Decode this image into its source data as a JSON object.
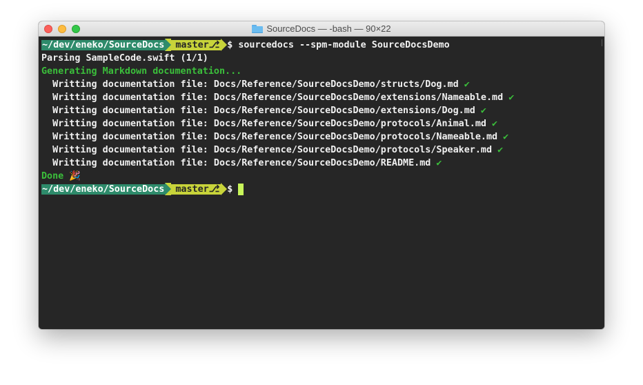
{
  "window": {
    "title": "SourceDocs — -bash — 90×22",
    "folder_icon": "folder-icon"
  },
  "colors": {
    "terminal_bg": "#262626",
    "prompt_path_bg": "#2e8b6b",
    "prompt_branch_bg": "#c8d43a",
    "success_green": "#3bbf3b",
    "cursor": "#c8f55a"
  },
  "prompt": {
    "path": "~/dev/eneko/SourceDocs",
    "branch": "master",
    "branch_icon": "⎇",
    "symbol": "$"
  },
  "output": {
    "command": "sourcedocs --spm-module SourceDocsDemo",
    "parsing": "Parsing SampleCode.swift (1/1)",
    "generating": "Generating Markdown documentation...",
    "writing_prefix": "  Writting documentation file: ",
    "files": [
      "Docs/Reference/SourceDocsDemo/structs/Dog.md",
      "Docs/Reference/SourceDocsDemo/extensions/Nameable.md",
      "Docs/Reference/SourceDocsDemo/extensions/Dog.md",
      "Docs/Reference/SourceDocsDemo/protocols/Animal.md",
      "Docs/Reference/SourceDocsDemo/protocols/Nameable.md",
      "Docs/Reference/SourceDocsDemo/protocols/Speaker.md",
      "Docs/Reference/SourceDocsDemo/README.md"
    ],
    "check": "✔",
    "done": "Done",
    "party": "🎉"
  }
}
